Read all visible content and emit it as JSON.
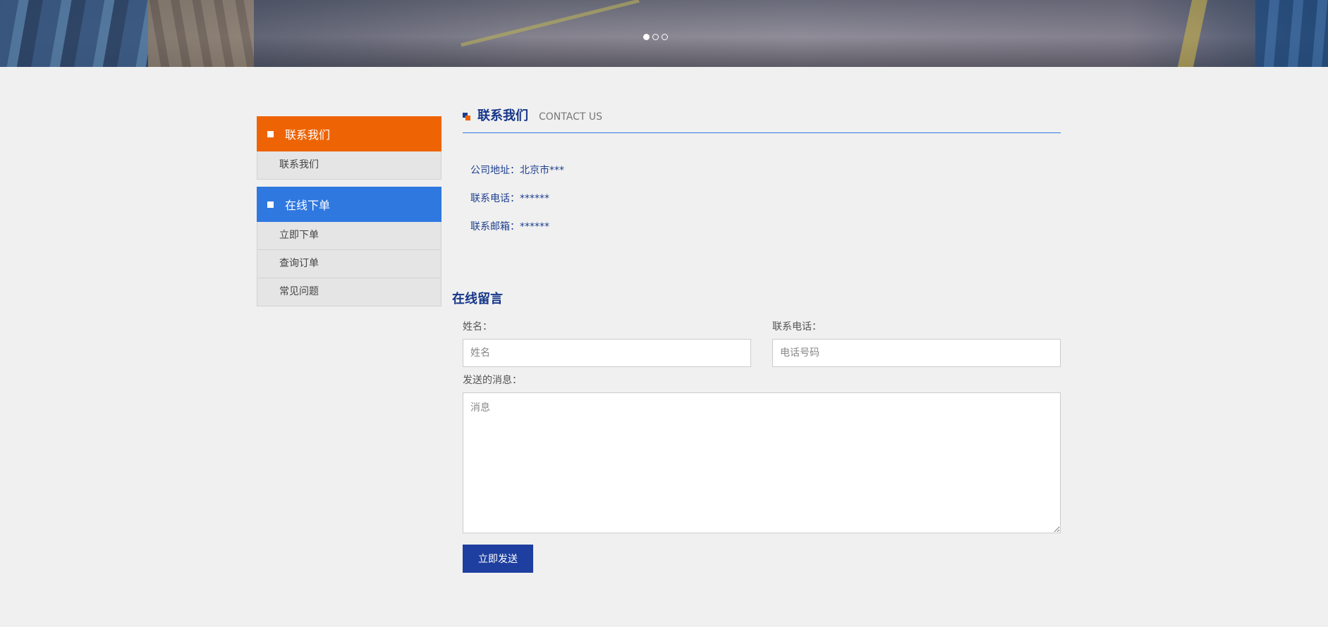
{
  "banner": {
    "slides": 3,
    "active_slide": 1
  },
  "sidebar": {
    "groups": [
      {
        "title": "联系我们",
        "color": "#ee6404",
        "items": [
          "联系我们"
        ]
      },
      {
        "title": "在线下单",
        "color": "#2f78e0",
        "items": [
          "立即下单",
          "查询订单",
          "常见问题"
        ]
      }
    ]
  },
  "contact": {
    "title": "联系我们",
    "subtitle": "CONTACT US",
    "address": "公司地址：北京市***",
    "phone": "联系电话：******",
    "email": "联系邮箱：******"
  },
  "message": {
    "title": "在线留言",
    "name_label": "姓名：",
    "name_placeholder": "姓名",
    "phone_label": "联系电话：",
    "phone_placeholder": "电话号码",
    "message_label": "发送的消息：",
    "message_placeholder": "消息",
    "submit_label": "立即发送"
  },
  "colors": {
    "accent_orange": "#ee6404",
    "accent_blue": "#2f78e0",
    "brand_navy": "#1e3f9f"
  }
}
